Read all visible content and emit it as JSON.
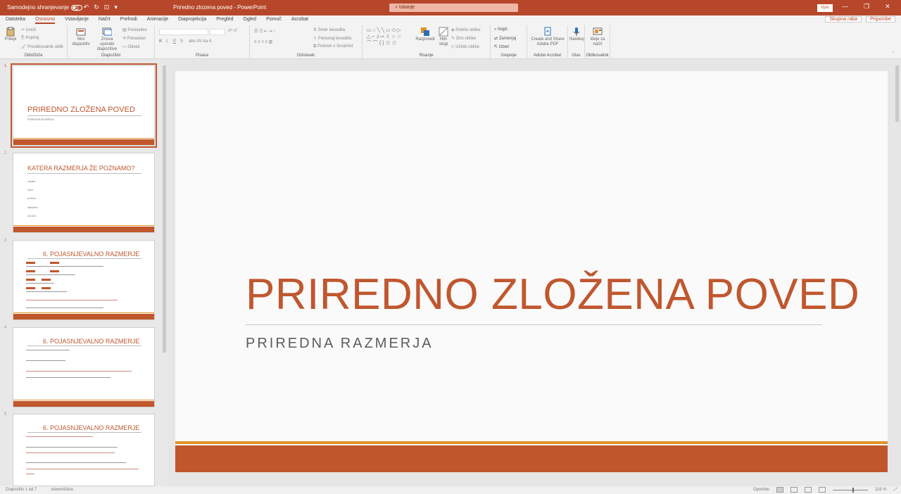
{
  "titlebar": {
    "autosave_label": "Samodejno shranjevanje",
    "doc_title": "Priredno zlozena poved - PowerPoint",
    "search_placeholder": "Iskanje",
    "signin_label": "Vpis",
    "window_buttons": [
      "—",
      "❐",
      "✕"
    ]
  },
  "tabs": [
    "Datoteka",
    "Osnovno",
    "Vstavljanje",
    "Načrt",
    "Prehodi",
    "Animacije",
    "Diaprojekcija",
    "Pregled",
    "Ogled",
    "Pomoč",
    "Acrobat"
  ],
  "tabs_right": {
    "share": "Skupna raba",
    "comments": "Pripombe"
  },
  "ribbon": {
    "clipboard": {
      "paste": "Prilepi",
      "cut": "Izreži",
      "copy": "Kopiraj",
      "format": "Preslikovalnik oblik",
      "label": "Odložišče"
    },
    "slides": {
      "new_slide": "Nov diapozitiv",
      "reuse": "Znova uporabi diapozitive",
      "layout": "Postavitev",
      "reset": "Ponastavi",
      "section": "Odsek",
      "label": "Diapozitivi"
    },
    "font": {
      "label": "Pisava",
      "format_buttons": [
        "K",
        "L",
        "P",
        "S"
      ]
    },
    "paragraph": {
      "label": "Odstavek",
      "text_direction": "Smer besedila",
      "align_text": "Poravnaj besedilo",
      "smartart": "Pretvori v SmartArt"
    },
    "drawing": {
      "arrange": "Razporedi",
      "quick_styles": "Hitri slogi",
      "fill": "Polnilo oblike",
      "outline": "Oris oblike",
      "effects": "Učinki oblike",
      "label": "Risanje"
    },
    "editing": {
      "find": "Najdi",
      "replace": "Zamenjaj",
      "select": "Izberi",
      "label": "Urejanje"
    },
    "acrobat": {
      "create": "Create and Share Adobe PDF",
      "label": "Adobe Acrobat"
    },
    "voice": {
      "dictate": "Narekuj",
      "label": "Glas"
    },
    "designer": {
      "ideas": "Ideje za načrt",
      "label": "Oblikovalnik"
    }
  },
  "thumbnails": [
    {
      "num": "1",
      "title": "PRIREDNO ZLOŽENA POVED",
      "subtitle": "PRIREDNA RAZMERJA"
    },
    {
      "num": "2",
      "title": "KATERA RAZMERJA ŽE POZNAMO?",
      "items": [
        "vezalno",
        "ločno",
        "protivno",
        "sklepalno",
        "vzročno"
      ]
    },
    {
      "num": "3",
      "title": "6. POJASNJEVALNO RAZMERJE"
    },
    {
      "num": "4",
      "title": "6. POJASNJEVALNO RAZMERJE"
    },
    {
      "num": "5",
      "title": "6. POJASNJEVALNO RAZMERJE"
    }
  ],
  "slide": {
    "title": "PRIREDNO ZLOŽENA POVED",
    "subtitle": "PRIREDNA RAZMERJA"
  },
  "status": {
    "slide_info": "Diapozitiv 1 od 7",
    "language": "slovenščina",
    "notes": "Opombe",
    "zoom": "116 %"
  },
  "colors": {
    "accent": "#b7472a",
    "slide_accent": "#bf562c",
    "stripe": "#e0932a"
  }
}
